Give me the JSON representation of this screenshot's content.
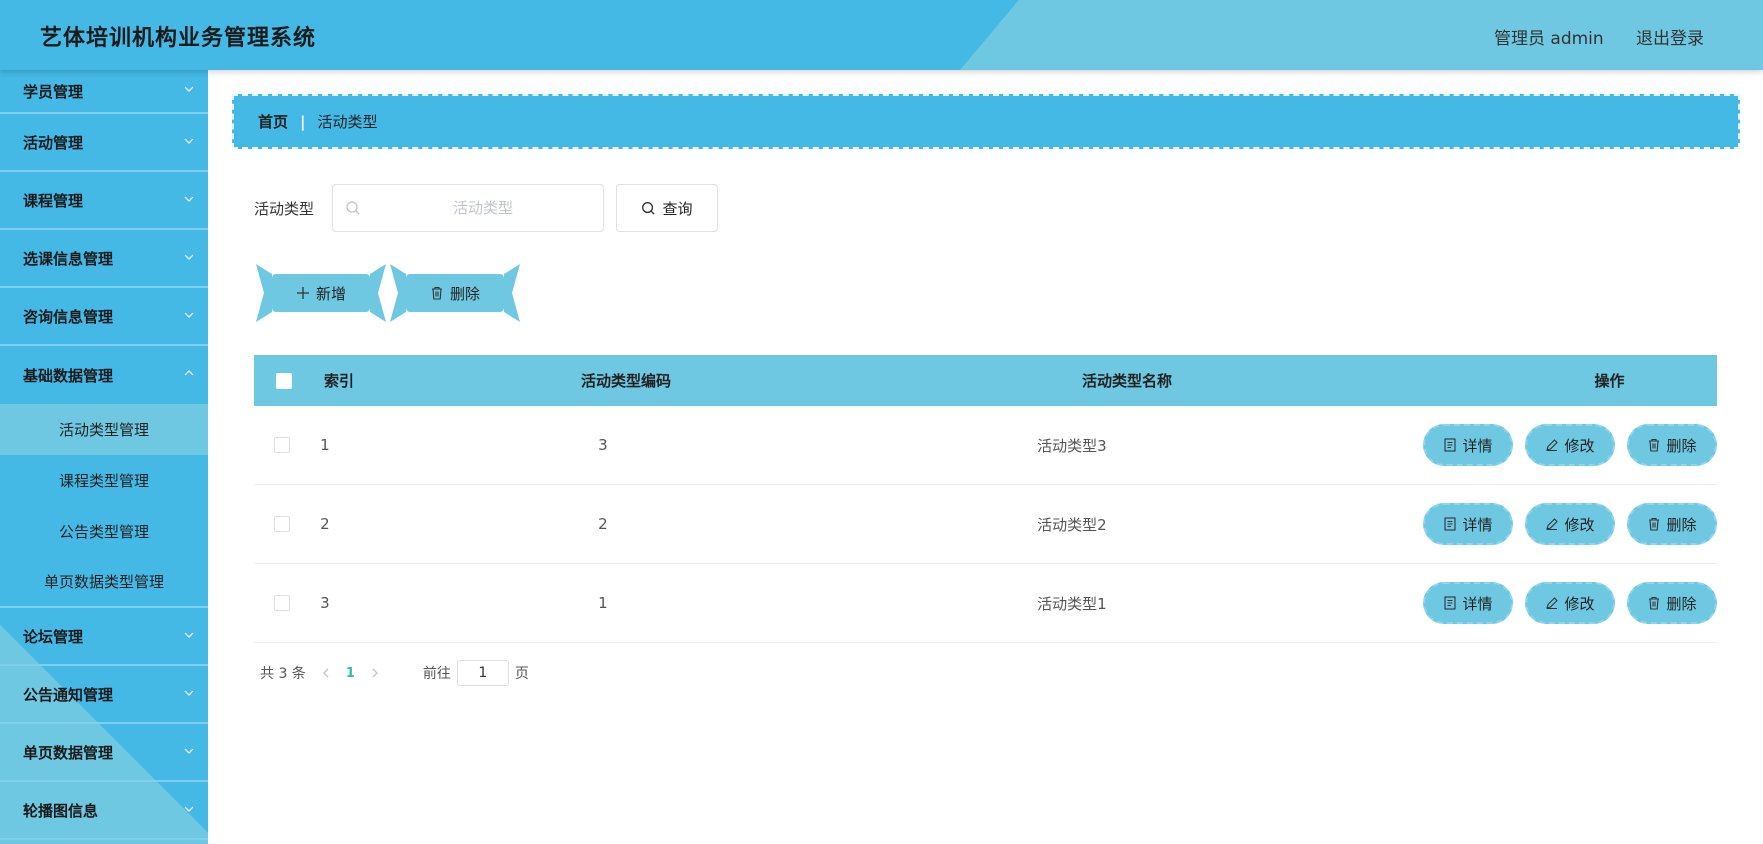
{
  "header": {
    "title": "艺体培训机构业务管理系统",
    "user": "管理员 admin",
    "logout": "退出登录"
  },
  "sidebar": {
    "items": [
      {
        "label": "学员管理"
      },
      {
        "label": "活动管理"
      },
      {
        "label": "课程管理"
      },
      {
        "label": "选课信息管理"
      },
      {
        "label": "咨询信息管理"
      },
      {
        "label": "基础数据管理"
      }
    ],
    "submenu": [
      {
        "label": "活动类型管理"
      },
      {
        "label": "课程类型管理"
      },
      {
        "label": "公告类型管理"
      },
      {
        "label": "单页数据类型管理"
      }
    ],
    "items_after": [
      {
        "label": "论坛管理"
      },
      {
        "label": "公告通知管理"
      },
      {
        "label": "单页数据管理"
      },
      {
        "label": "轮播图信息"
      }
    ]
  },
  "breadcrumb": {
    "home": "首页",
    "current": "活动类型"
  },
  "search": {
    "label": "活动类型",
    "placeholder": "活动类型",
    "button": "查询"
  },
  "actions": {
    "add": "新增",
    "delete": "删除"
  },
  "table": {
    "headers": {
      "index": "索引",
      "code": "活动类型编码",
      "name": "活动类型名称",
      "ops": "操作"
    },
    "rows": [
      {
        "index": "1",
        "code": "3",
        "name": "活动类型3"
      },
      {
        "index": "2",
        "code": "2",
        "name": "活动类型2"
      },
      {
        "index": "3",
        "code": "1",
        "name": "活动类型1"
      }
    ],
    "op_labels": {
      "detail": "详情",
      "edit": "修改",
      "delete": "删除"
    }
  },
  "pagination": {
    "total": "共 3 条",
    "current_page": "1",
    "goto_prefix": "前往",
    "goto_value": "1",
    "goto_suffix": "页"
  },
  "colors": {
    "primary": "#44b9e6",
    "secondary": "#6fc8e2",
    "active_page": "#2bbfa0"
  }
}
